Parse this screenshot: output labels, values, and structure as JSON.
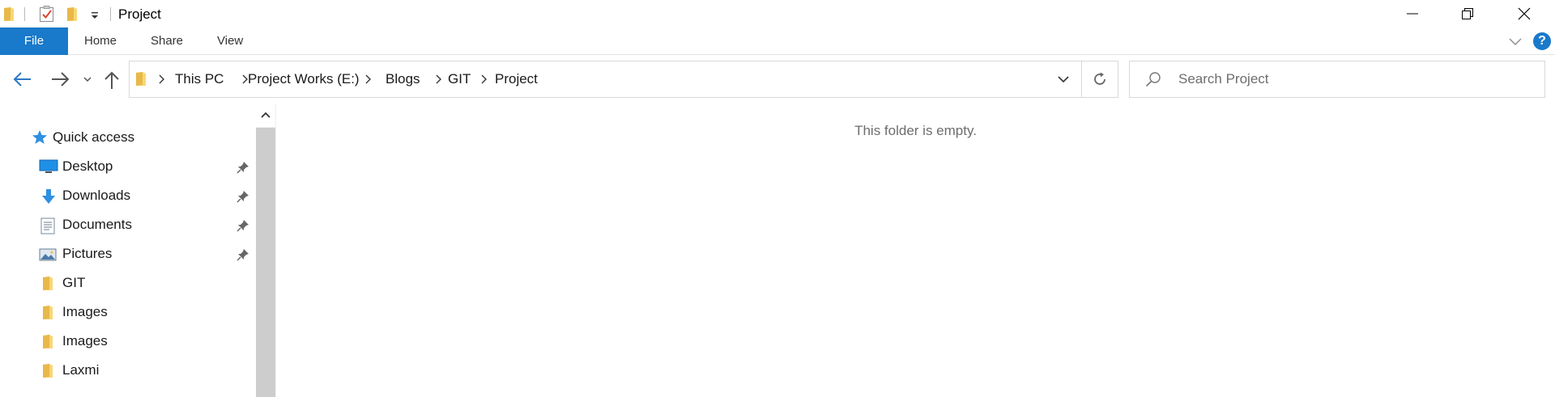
{
  "window": {
    "title": "Project"
  },
  "ribbon": {
    "tabs": [
      {
        "label": "File",
        "active": true
      },
      {
        "label": "Home"
      },
      {
        "label": "Share"
      },
      {
        "label": "View"
      }
    ],
    "help_label": "?"
  },
  "address": {
    "crumbs": [
      "This PC",
      "Project Works (E:)",
      "Blogs",
      "GIT",
      "Project"
    ]
  },
  "search": {
    "placeholder": "Search Project",
    "value": ""
  },
  "nav_pane": {
    "quick_access_label": "Quick access",
    "items": [
      {
        "label": "Desktop",
        "icon": "desktop-icon",
        "pinned": true
      },
      {
        "label": "Downloads",
        "icon": "downloads-icon",
        "pinned": true
      },
      {
        "label": "Documents",
        "icon": "documents-icon",
        "pinned": true
      },
      {
        "label": "Pictures",
        "icon": "pictures-icon",
        "pinned": true
      },
      {
        "label": "GIT",
        "icon": "folder-icon",
        "pinned": false
      },
      {
        "label": "Images",
        "icon": "folder-icon",
        "pinned": false
      },
      {
        "label": "Images",
        "icon": "folder-icon",
        "pinned": false
      },
      {
        "label": "Laxmi",
        "icon": "folder-icon",
        "pinned": false
      }
    ]
  },
  "content": {
    "empty_message": "This folder is empty."
  },
  "colors": {
    "accent": "#1979ca",
    "folder_yellow": "#f7c94b",
    "text_muted": "#6d6d6d"
  }
}
